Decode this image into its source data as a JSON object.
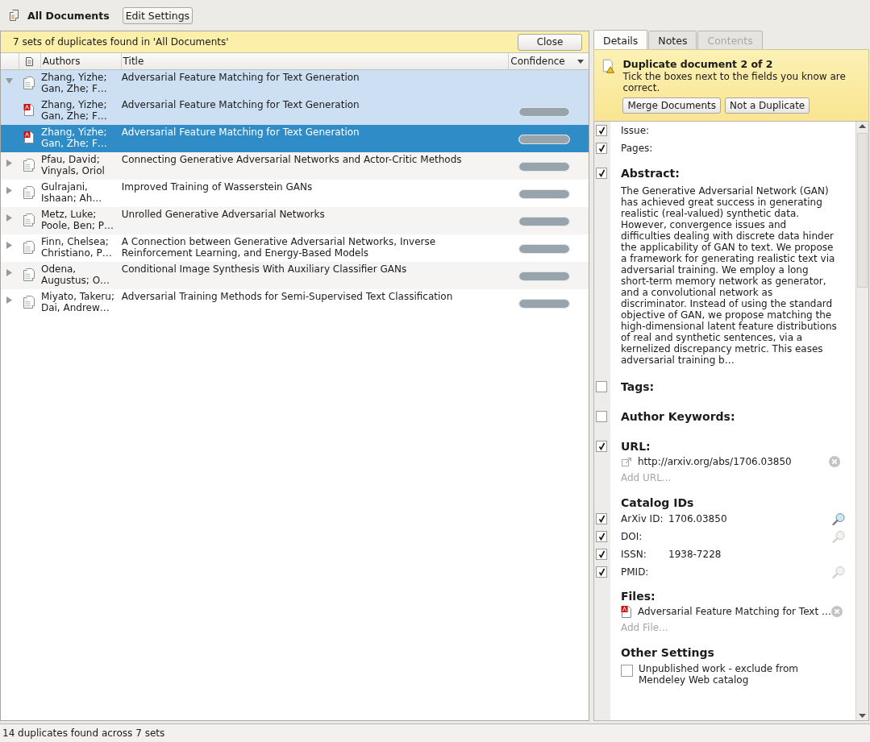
{
  "toolbar": {
    "title": "All Documents",
    "button": "Edit Settings"
  },
  "banner": {
    "message": "7 sets of duplicates found in 'All Documents'",
    "button": "Close"
  },
  "table": {
    "columns": [
      {
        "label": "Authors",
        "sorted": false
      },
      {
        "label": "Title",
        "sorted": false
      },
      {
        "label": "Confidence",
        "sorted": true
      }
    ],
    "rows": [
      {
        "kind": "group",
        "expanded": true,
        "selected": false,
        "authors": "Zhang, Yizhe; Gan, Zhe; F…",
        "title": "Adversarial Feature Matching for Text Generation",
        "children": [
          {
            "kind": "pdf",
            "selected": false,
            "authors": "Zhang, Yizhe; Gan, Zhe; F…",
            "title": "Adversarial Feature Matching for Text Generation",
            "level": 1
          },
          {
            "kind": "pdf",
            "selected": true,
            "authors": "Zhang, Yizhe; Gan, Zhe; F…",
            "title": "Adversarial Feature Matching for Text Generation",
            "level": 1
          }
        ]
      },
      {
        "kind": "group",
        "expanded": false,
        "selected": false,
        "authors": "Pfau, David; Vinyals, Oriol",
        "title": "Connecting Generative Adversarial Networks and Actor-Critic Methods",
        "level": 1
      },
      {
        "kind": "group",
        "expanded": false,
        "selected": false,
        "authors": "Gulrajani, Ishaan; Ah…",
        "title": "Improved Training of Wasserstein GANs",
        "level": 1
      },
      {
        "kind": "group",
        "expanded": false,
        "selected": false,
        "authors": "Metz, Luke; Poole, Ben; P…",
        "title": "Unrolled Generative Adversarial Networks",
        "level": 1
      },
      {
        "kind": "group",
        "expanded": false,
        "selected": false,
        "authors": "Finn, Chelsea; Christiano, P…",
        "title": "A Connection between Generative Adversarial Networks, Inverse Reinforcement Learning, and Energy-Based Models",
        "level": 1
      },
      {
        "kind": "group",
        "expanded": false,
        "selected": false,
        "authors": "Odena, Augustus; O…",
        "title": "Conditional Image Synthesis With Auxiliary Classifier GANs",
        "level": 1
      },
      {
        "kind": "group",
        "expanded": false,
        "selected": false,
        "authors": "Miyato, Takeru; Dai, Andrew…",
        "title": "Adversarial Training Methods for Semi-Supervised Text Classification",
        "level": 1
      }
    ]
  },
  "tabs": [
    {
      "label": "Details",
      "selected": true,
      "disabled": false
    },
    {
      "label": "Notes",
      "selected": false,
      "disabled": false
    },
    {
      "label": "Contents",
      "selected": false,
      "disabled": true
    }
  ],
  "notice": {
    "title": "Duplicate document 2 of 2",
    "message": "Tick the boxes next to the fields you know are correct.",
    "buttons": [
      "Merge Documents",
      "Not a Duplicate"
    ]
  },
  "details": [
    {
      "kind": "field",
      "label": "Issue:",
      "checked": true
    },
    {
      "kind": "field",
      "label": "Pages:",
      "checked": true
    },
    {
      "kind": "text",
      "label": "Abstract:",
      "checked": true,
      "text": "The Generative Adversarial Network (GAN) has achieved great success in generating realistic (real-valued) synthetic data. However, convergence issues and difficulties dealing with discrete data hinder the applicability of GAN to text. We propose a framework for generating realistic text via adversarial training. We employ a long short-term memory network as generator, and a convolutional network as discriminator. Instead of using the standard objective of GAN, we propose matching the high-dimensional latent feature distributions of real and synthetic sentences, via a kernelized discrepancy metric. This eases adversarial training b…"
    },
    {
      "kind": "heading",
      "label": "Tags:",
      "checked": false
    },
    {
      "kind": "heading",
      "label": "Author Keywords:",
      "checked": false
    },
    {
      "kind": "url",
      "label": "URL:",
      "checked": true,
      "value": "http://arxiv.org/abs/1706.03850",
      "add": "Add URL..."
    },
    {
      "kind": "ids",
      "label": "Catalog IDs",
      "ids": [
        {
          "label": "ArXiv ID:",
          "value": "1706.03850",
          "checked": true,
          "searchable": true
        },
        {
          "label": "DOI:",
          "checked": true,
          "searchable": false
        },
        {
          "label": "ISSN:",
          "value": "1938-7228",
          "checked": true
        },
        {
          "label": "PMID:",
          "checked": true,
          "searchable": false
        }
      ]
    },
    {
      "kind": "files",
      "label": "Files:",
      "file": "Adversarial Feature Matching for Text …",
      "add": "Add File..."
    },
    {
      "kind": "option",
      "label": "Other Settings",
      "option": "Unpublished work - exclude from Mendeley Web catalog",
      "checked": false
    }
  ],
  "status_bar": "14 duplicates found across 7 sets"
}
